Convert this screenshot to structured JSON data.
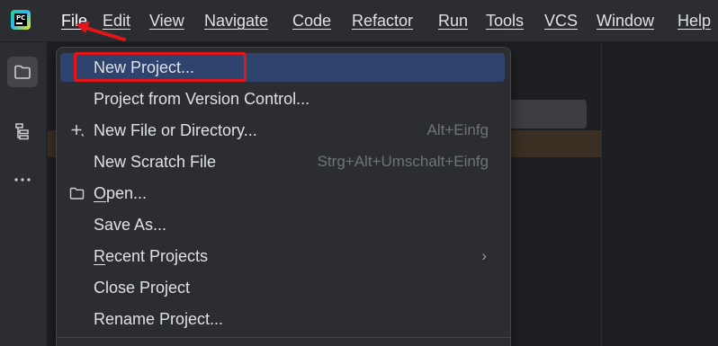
{
  "menubar": {
    "logo": "pycharm-logo",
    "items": [
      {
        "label": "File",
        "active": true
      },
      {
        "label": "Edit"
      },
      {
        "label": "View"
      },
      {
        "label": "Navigate"
      },
      {
        "label": "Code"
      },
      {
        "label": "Refactor"
      },
      {
        "label": "Run"
      },
      {
        "label": "Tools"
      },
      {
        "label": "VCS"
      },
      {
        "label": "Window"
      },
      {
        "label": "Help"
      }
    ]
  },
  "toolstrip": {
    "items": [
      {
        "icon": "folder-icon",
        "selected": true
      },
      {
        "icon": "structure-icon"
      },
      {
        "icon": "more-icon"
      }
    ]
  },
  "file_menu": {
    "items": [
      {
        "label": "New Project...",
        "highlighted": true
      },
      {
        "label": "Project from Version Control..."
      },
      {
        "label": "New File or Directory...",
        "icon": "plus-icon",
        "shortcut": "Alt+Einfg"
      },
      {
        "label": "New Scratch File",
        "shortcut": "Strg+Alt+Umschalt+Einfg"
      },
      {
        "label_mnemonic": "O",
        "label_rest": "pen...",
        "icon": "folder-open-icon"
      },
      {
        "label": "Save As..."
      },
      {
        "label_mnemonic": "R",
        "label_rest": "ecent Projects",
        "submenu": "›"
      },
      {
        "label": "Close Project"
      },
      {
        "label": "Rename Project..."
      }
    ]
  },
  "colors": {
    "background": "#1e1f22",
    "panel": "#2b2d30",
    "selection": "#2e436e",
    "annotation": "#e0161b"
  }
}
